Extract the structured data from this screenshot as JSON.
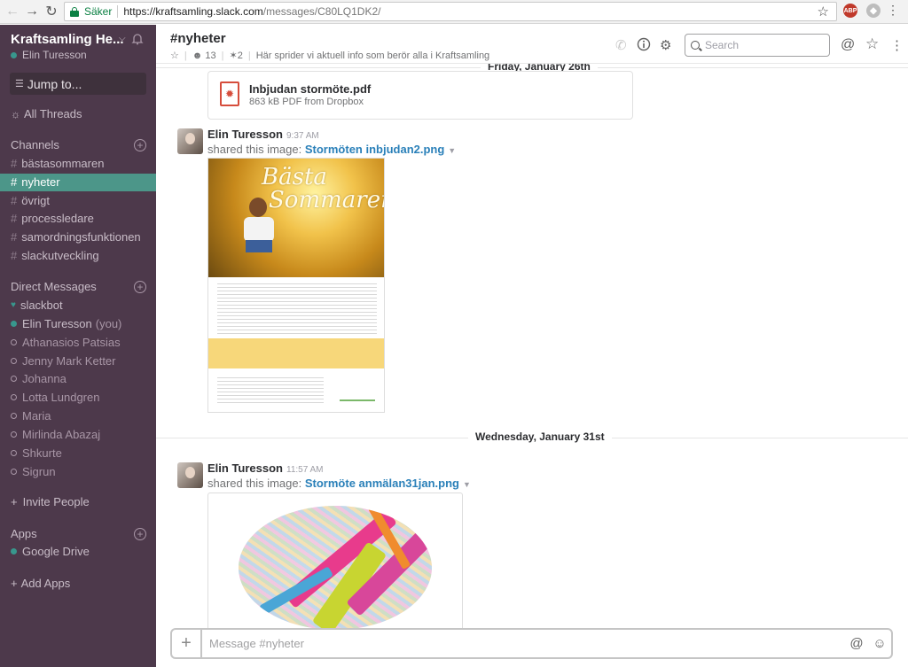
{
  "browser": {
    "secure_label": "Säker",
    "url_host": "https://kraftsamling.slack.com",
    "url_path": "/messages/C80LQ1DK2/",
    "ext_abp": "ABP"
  },
  "sidebar": {
    "team_name": "Kraftsamling He...",
    "user_name": "Elin Turesson",
    "jump_to": "Jump to...",
    "all_threads": "All Threads",
    "channels_header": "Channels",
    "channels": [
      "bästasommaren",
      "nyheter",
      "övrigt",
      "processledare",
      "samordningsfunktionen",
      "slackutveckling"
    ],
    "active_channel": "nyheter",
    "dm_header": "Direct Messages",
    "dms": [
      {
        "name": "slackbot",
        "status": "bot"
      },
      {
        "name": "Elin Turesson",
        "status": "online",
        "suffix": "(you)"
      },
      {
        "name": "Athanasios Patsias",
        "status": "away"
      },
      {
        "name": "Jenny Mark Ketter",
        "status": "away"
      },
      {
        "name": "Johanna",
        "status": "away"
      },
      {
        "name": "Lotta Lundgren",
        "status": "away"
      },
      {
        "name": "Maria",
        "status": "away"
      },
      {
        "name": "Mirlinda Abazaj",
        "status": "away"
      },
      {
        "name": "Shkurte",
        "status": "away"
      },
      {
        "name": "Sigrun",
        "status": "away"
      }
    ],
    "invite_people": "Invite People",
    "apps_header": "Apps",
    "apps": [
      "Google Drive"
    ],
    "add_apps": "Add Apps"
  },
  "header": {
    "channel_title": "#nyheter",
    "member_count": "13",
    "pinned_count": "2",
    "topic": "Här sprider vi aktuell info som berör alla i Kraftsamling",
    "search_placeholder": "Search"
  },
  "messages": {
    "day1": "Friday, January 26th",
    "file_name": "Inbjudan stormöte.pdf",
    "file_meta": "863 kB PDF from Dropbox",
    "msg1_author": "Elin Turesson",
    "msg1_time": "9:37 AM",
    "msg1_shared": "shared this image:",
    "msg1_file": "Stormöten inbjudan2.png",
    "poster_title_1": "Bästa",
    "poster_title_2": "Sommaren",
    "day2": "Wednesday, January 31st",
    "msg2_author": "Elin Turesson",
    "msg2_time": "11:57 AM",
    "msg2_shared": "shared this image:",
    "msg2_file": "Stormöte anmälan31jan.png"
  },
  "composer": {
    "placeholder": "Message #nyheter"
  },
  "colors": {
    "sidebar_bg": "#4d394b",
    "active_channel_bg": "#4c9689",
    "link": "#2a80b9"
  }
}
